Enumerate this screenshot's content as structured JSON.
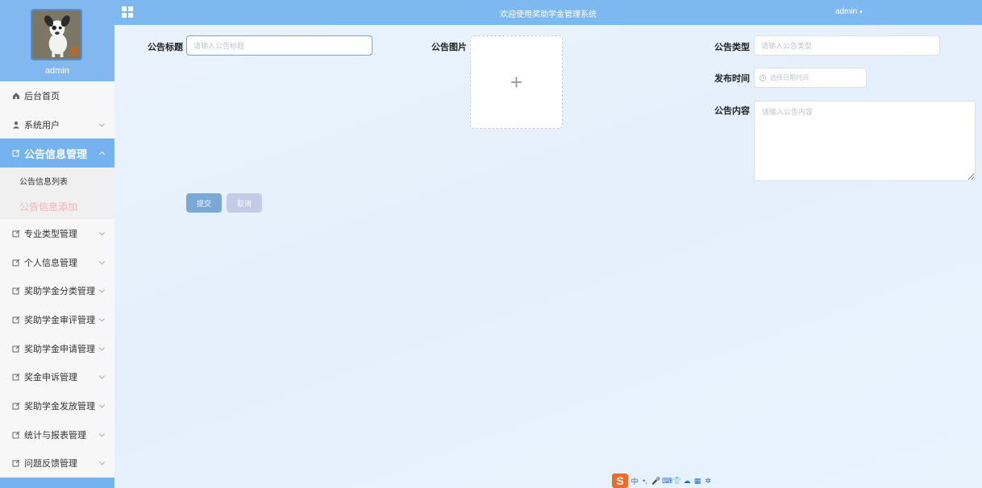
{
  "header": {
    "title": "欢迎使用奖助学金管理系统",
    "user": "admin"
  },
  "profile": {
    "name": "admin"
  },
  "sidebar": {
    "items": [
      {
        "label": "后台首页",
        "icon": "home-icon"
      },
      {
        "label": "系统用户",
        "icon": "user-icon"
      },
      {
        "label": "公告信息管理",
        "icon": "edit-icon",
        "active": true
      },
      {
        "label": "专业类型管理",
        "icon": "edit-icon"
      },
      {
        "label": "个人信息管理",
        "icon": "edit-icon"
      },
      {
        "label": "奖助学金分类管理",
        "icon": "edit-icon"
      },
      {
        "label": "奖助学金审评管理",
        "icon": "edit-icon"
      },
      {
        "label": "奖助学金申请管理",
        "icon": "edit-icon"
      },
      {
        "label": "奖金申诉管理",
        "icon": "edit-icon"
      },
      {
        "label": "奖助学金发放管理",
        "icon": "edit-icon"
      },
      {
        "label": "统计与报表管理",
        "icon": "edit-icon"
      },
      {
        "label": "问题反馈管理",
        "icon": "edit-icon"
      }
    ],
    "subitems": [
      {
        "label": "公告信息列表"
      },
      {
        "label": "公告信息添加",
        "current": true
      }
    ]
  },
  "form": {
    "title_label": "公告标题",
    "title_placeholder": "请输入公告标题",
    "image_label": "公告图片",
    "type_label": "公告类型",
    "type_placeholder": "请输入公告类型",
    "time_label": "发布时间",
    "time_placeholder": "选择日期时间",
    "content_label": "公告内容",
    "content_placeholder": "请输入公告内容",
    "submit_label": "提交",
    "cancel_label": "取消",
    "upload_symbol": "+"
  },
  "ime": {
    "logo": "S",
    "items": [
      "中",
      "•,",
      "🎤",
      "⌨",
      "👕",
      "☁",
      "▦",
      "✲"
    ]
  },
  "colors": {
    "accent": "#74b3ef",
    "topbar": "#7db9f0",
    "submit": "#7aa9d8",
    "cancel": "#c3cbe8",
    "current_sub": "#f5b5b5"
  }
}
